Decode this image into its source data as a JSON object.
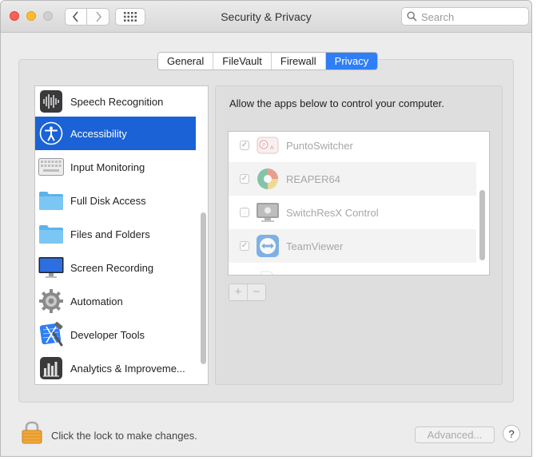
{
  "window": {
    "title": "Security & Privacy"
  },
  "search": {
    "placeholder": "Search"
  },
  "tabs": [
    {
      "label": "General",
      "active": false
    },
    {
      "label": "FileVault",
      "active": false
    },
    {
      "label": "Firewall",
      "active": false
    },
    {
      "label": "Privacy",
      "active": true
    }
  ],
  "sidebar": {
    "items": [
      {
        "label": "Speech Recognition",
        "icon": "waveform-icon",
        "selected": false
      },
      {
        "label": "Accessibility",
        "icon": "accessibility-icon",
        "selected": true
      },
      {
        "label": "Input Monitoring",
        "icon": "keyboard-icon",
        "selected": false
      },
      {
        "label": "Full Disk Access",
        "icon": "folder-icon",
        "selected": false
      },
      {
        "label": "Files and Folders",
        "icon": "folder-icon",
        "selected": false
      },
      {
        "label": "Screen Recording",
        "icon": "display-icon",
        "selected": false
      },
      {
        "label": "Automation",
        "icon": "gear-icon",
        "selected": false
      },
      {
        "label": "Developer Tools",
        "icon": "xcode-icon",
        "selected": false
      },
      {
        "label": "Analytics & Improveme...",
        "icon": "analytics-icon",
        "selected": false
      }
    ]
  },
  "pane": {
    "description": "Allow the apps below to control your computer.",
    "apps": [
      {
        "name": "PuntoSwitcher",
        "checked": true,
        "icon": "punto-switcher-icon"
      },
      {
        "name": "REAPER64",
        "checked": true,
        "icon": "reaper-icon"
      },
      {
        "name": "SwitchResX Control",
        "checked": false,
        "icon": "switchresx-icon"
      },
      {
        "name": "TeamViewer",
        "checked": true,
        "icon": "teamviewer-icon"
      }
    ],
    "add_label": "+",
    "remove_label": "−"
  },
  "footer": {
    "lock_text": "Click the lock to make changes.",
    "advanced_label": "Advanced...",
    "help_label": "?"
  },
  "colors": {
    "accent": "#2f7ef6",
    "selection": "#1a62d6"
  }
}
